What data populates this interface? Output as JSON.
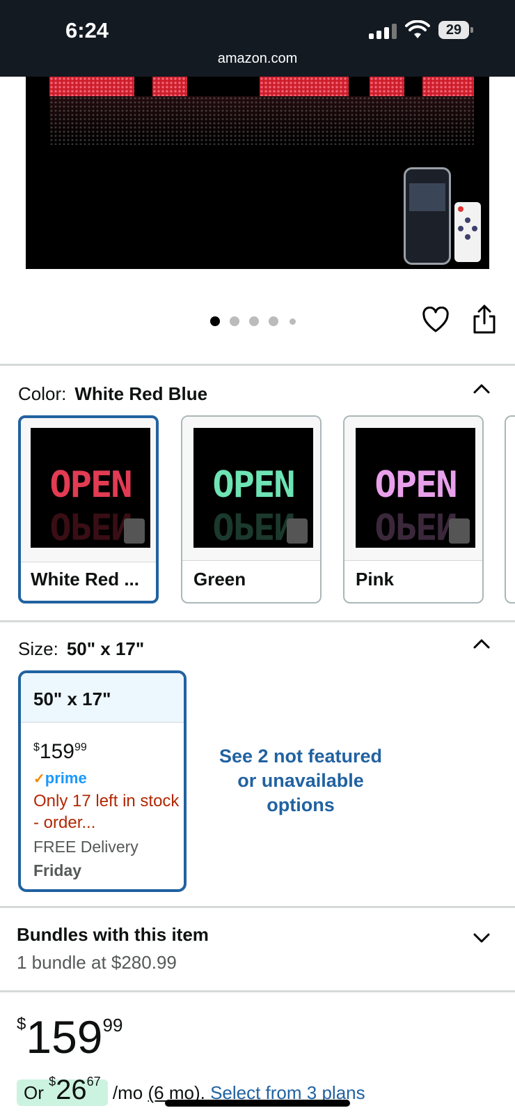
{
  "status_bar": {
    "time": "6:24",
    "domain": "amazon.com",
    "battery": "29"
  },
  "gallery": {
    "dots": 5,
    "active_dot": 0
  },
  "color": {
    "label": "Color:",
    "selected": "White Red Blue",
    "options": [
      {
        "name": "White Red ...",
        "sign_text": "OPEN",
        "text_color": "#d9324a"
      },
      {
        "name": "Green",
        "sign_text": "OPEN",
        "text_color": "#68e6b0"
      },
      {
        "name": "Pink",
        "sign_text": "OPEN",
        "text_color": "#e89ae8"
      }
    ]
  },
  "size": {
    "label": "Size:",
    "selected": "50\" x 17\"",
    "card": {
      "title": "50\" x 17\"",
      "currency": "$",
      "price_whole": "159",
      "price_cents": "99",
      "prime": "prime",
      "stock": "Only 17 left in stock - order...",
      "delivery": "FREE Delivery",
      "delivery_day": "Friday"
    },
    "see_more": "See 2 not featured or unavailable options"
  },
  "bundles": {
    "title": "Bundles with this item",
    "subtitle": "1 bundle at $280.99"
  },
  "price": {
    "currency": "$",
    "whole": "159",
    "cents": "99"
  },
  "monthly": {
    "prefix": "Or",
    "currency": "$",
    "whole": "26",
    "cents": "67",
    "suffix": "/mo",
    "term": "(6 mo).",
    "link": "Select from 3 plans"
  },
  "colors": {
    "accent": "#2162a1",
    "status_bar": "#131a22",
    "stock_red": "#b12704",
    "pill_green": "#ccf3e0"
  }
}
